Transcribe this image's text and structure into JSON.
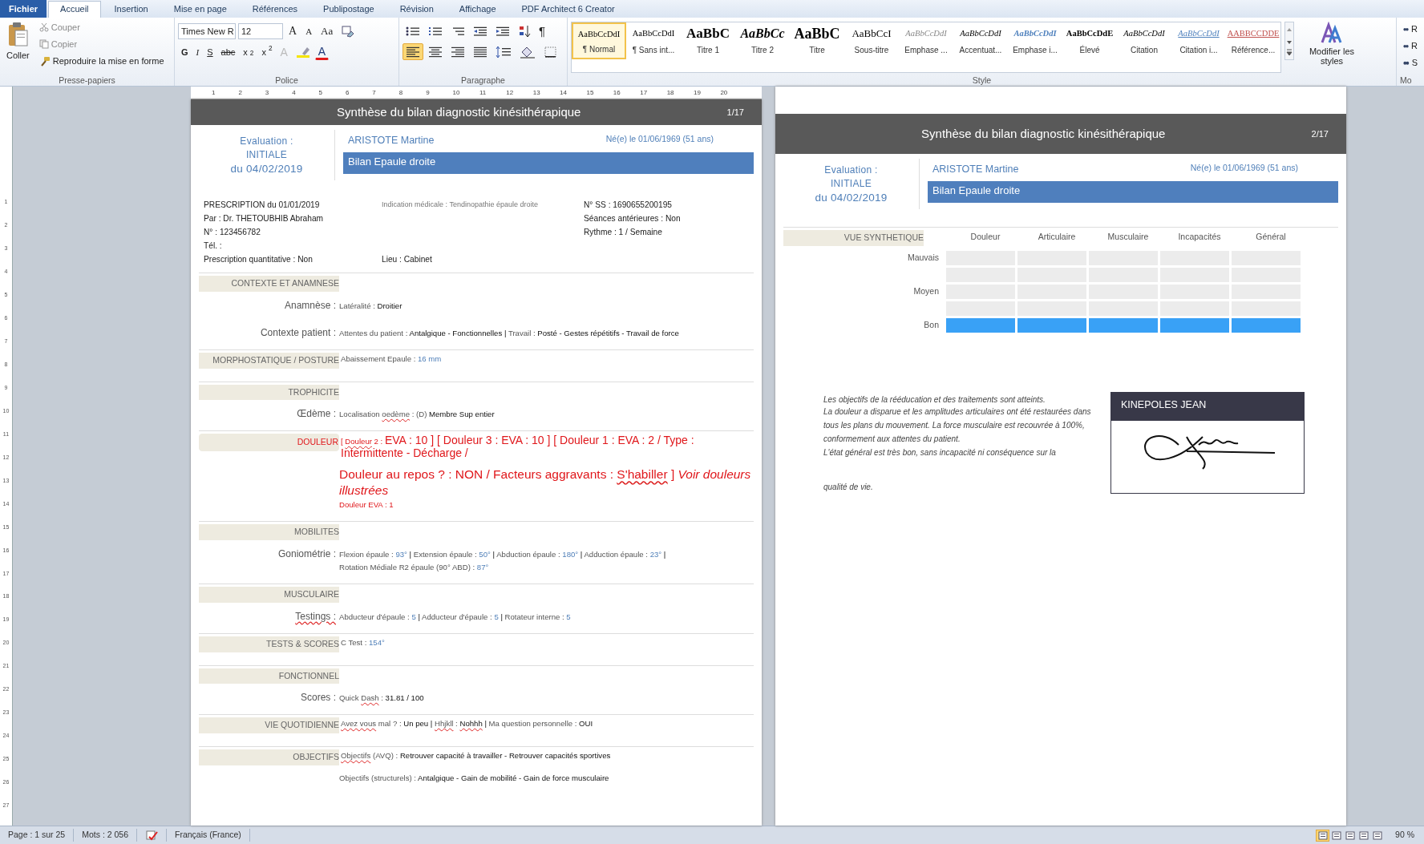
{
  "ribbon": {
    "tabs": [
      {
        "label": "Fichier",
        "kind": "file",
        "selected": false
      },
      {
        "label": "Accueil",
        "kind": "tab",
        "selected": true
      },
      {
        "label": "Insertion",
        "kind": "tab",
        "selected": false
      },
      {
        "label": "Mise en page",
        "kind": "tab",
        "selected": false
      },
      {
        "label": "Références",
        "kind": "tab",
        "selected": false
      },
      {
        "label": "Publipostage",
        "kind": "tab",
        "selected": false
      },
      {
        "label": "Révision",
        "kind": "tab",
        "selected": false
      },
      {
        "label": "Affichage",
        "kind": "tab",
        "selected": false
      },
      {
        "label": "PDF Architect 6 Creator",
        "kind": "tab",
        "selected": false
      }
    ],
    "clipboard": {
      "paste": "Coller",
      "cut": "Couper",
      "copy": "Copier",
      "format_painter": "Reproduire la mise en forme",
      "title": "Presse-papiers"
    },
    "font": {
      "font_name": "Times New R",
      "font_size": "12",
      "grow": "A",
      "shrink": "A",
      "change_case": "Aa",
      "bold": "G",
      "italic": "I",
      "underline": "S",
      "strikethrough": "abc",
      "subscript": "x$_{2}$",
      "superscript": "x$^{2}$",
      "text_effects": "A",
      "font_color": "A",
      "title": "Police"
    },
    "paragraph": {
      "pilcrow": "¶",
      "alignments": [
        {
          "selected": true
        },
        {
          "selected": false
        },
        {
          "selected": false
        },
        {
          "selected": false
        }
      ],
      "title": "Paragraphe"
    },
    "styles": {
      "items": [
        {
          "preview": "AaBbCcDdI",
          "name": "¶ Normal",
          "kind": "normal",
          "selected": true
        },
        {
          "preview": "AaBbCcDdI",
          "name": "¶ Sans int...",
          "kind": "normal",
          "selected": false
        },
        {
          "preview": "AaBbC",
          "name": "Titre 1",
          "kind": "heading1",
          "selected": false
        },
        {
          "preview": "AaBbCc",
          "name": "Titre 2",
          "kind": "heading2",
          "selected": false
        },
        {
          "preview": "AaBbC",
          "name": "Titre",
          "kind": "title",
          "selected": false
        },
        {
          "preview": "AaBbCcI",
          "name": "Sous-titre",
          "kind": "subtitle",
          "selected": false
        },
        {
          "preview": "AaBbCcDdI",
          "name": "Emphase ...",
          "kind": "subtle",
          "selected": false
        },
        {
          "preview": "AaBbCcDdI",
          "name": "Accentuat...",
          "kind": "emphasis",
          "selected": false
        },
        {
          "preview": "AaBbCcDdI",
          "name": "Emphase i...",
          "kind": "intense",
          "selected": false
        },
        {
          "preview": "AaBbCcDdE",
          "name": "Élevé",
          "kind": "strong",
          "selected": false
        },
        {
          "preview": "AaBbCcDdI",
          "name": "Citation",
          "kind": "emphasis",
          "selected": false
        },
        {
          "preview": "AaBbCcDdI",
          "name": "Citation i...",
          "kind": "quote",
          "selected": false
        },
        {
          "preview": "AABBCCDDE",
          "name": "Référence...",
          "kind": "reference",
          "selected": false
        }
      ],
      "change_styles": "Modifier les styles",
      "title": "Style"
    },
    "editing": {
      "items": [
        "R",
        "R",
        "S"
      ],
      "title": "Mo"
    }
  },
  "ruler": {
    "marks": [
      "1",
      "2",
      "3",
      "4",
      "5",
      "6",
      "7",
      "8",
      "9",
      "10",
      "11",
      "12",
      "13",
      "14",
      "15",
      "16",
      "17",
      "18",
      "19",
      "20"
    ]
  },
  "vertical_ruler": {
    "marks": [
      "1",
      "2",
      "3",
      "4",
      "5",
      "6",
      "7",
      "8",
      "9",
      "10",
      "11",
      "12",
      "13",
      "14",
      "15",
      "16",
      "17",
      "18",
      "19",
      "20",
      "21",
      "22",
      "23",
      "24",
      "25",
      "26",
      "27"
    ]
  },
  "pages": [
    {
      "title": "Synthèse du bilan diagnostic kinésithérapique",
      "page_number": "1/17",
      "evaluation": {
        "label": "Evaluation :",
        "type": "INITIALE",
        "date": "du 04/02/2019"
      },
      "patient": "ARISTOTE  Martine",
      "birth": "Né(e) le 01/06/1969 (51 ans)",
      "bilan": "Bilan  Epaule  droite",
      "prescription": {
        "left": [
          "PRESCRIPTION du 01/01/2019",
          "Par : Dr. THETOUBHIB Abraham",
          "N° : 123456782",
          "Tél. :",
          "Prescription quantitative : Non"
        ],
        "indication": "Indication médicale : Tendinopathie épaule droite",
        "place": "Lieu : Cabinet",
        "right": [
          "N° SS : 1690655200195",
          "Séances antérieures : Non",
          "Rythme : 1 / Semaine"
        ]
      },
      "sections": [
        {
          "title": "CONTEXTE  ET  ANAMNESE",
          "rows": [
            {
              "label": "Anamnèse :",
              "lines": [
                [
                  {
                    "text": "Latéralité : ",
                    "kind": "label"
                  },
                  {
                    "text": "Droitier",
                    "kind": "value"
                  }
                ]
              ]
            },
            {
              "label": "Contexte patient :",
              "lines": [
                [
                  {
                    "text": "Attentes du patient : ",
                    "kind": "label"
                  },
                  {
                    "text": "Antalgique - Fonctionnelles | ",
                    "kind": "value"
                  },
                  {
                    "text": "Travail : ",
                    "kind": "label"
                  },
                  {
                    "text": "Posté - Gestes répétitifs - Travail de force",
                    "kind": "value"
                  }
                ]
              ]
            }
          ]
        },
        {
          "title": "MORPHOSTATIQUE / POSTURE",
          "inline": [
            {
              "text": "Abaissement Epaule : ",
              "kind": "label"
            },
            {
              "text": "16 mm",
              "kind": "number"
            }
          ]
        },
        {
          "title": "TROPHICITE",
          "rows": [
            {
              "label": "Œdème :",
              "lines": [
                [
                  {
                    "text": "Localisation ",
                    "kind": "label"
                  },
                  {
                    "text": "oedème",
                    "kind": "label",
                    "misspelled": true
                  },
                  {
                    "text": " : (D) ",
                    "kind": "label"
                  },
                  {
                    "text": "Membre Sup entier",
                    "kind": "value"
                  }
                ]
              ]
            }
          ]
        },
        {
          "title": "DOULEUR",
          "alert": true,
          "inline": [
            {
              "text": "[ ",
              "kind": "alert-small"
            },
            {
              "text": "Douleur",
              "kind": "alert-small",
              "misspelled": true
            },
            {
              "text": " 2 : ",
              "kind": "alert-small"
            },
            {
              "text": "EVA  : 10 ] [ Douleur 3 : EVA  : 10 ] [ Douleur 1 : EVA  : 2 / Type : Intermittente - Décharge /",
              "kind": "alert-medium"
            }
          ],
          "rows": [
            {
              "lines": [
                [
                  {
                    "text": "Douleur au repos ? : NON / Facteurs aggravants : ",
                    "kind": "alert-large"
                  },
                  {
                    "text": "S'habiller",
                    "kind": "alert-large",
                    "misspelled": true
                  },
                  {
                    "text": " ] *Voir douleurs illustrées*",
                    "kind": "alert-large"
                  }
                ],
                [
                  {
                    "text": "Douleur EVA : 1",
                    "kind": "alert-small"
                  }
                ]
              ]
            }
          ]
        },
        {
          "title": "MOBILITES",
          "rows": [
            {
              "label": "Goniométrie :",
              "lines": [
                [
                  {
                    "text": "Flexion épaule : ",
                    "kind": "label"
                  },
                  {
                    "text": "93°",
                    "kind": "number"
                  },
                  {
                    "text": " | ",
                    "kind": "value"
                  },
                  {
                    "text": "Extension épaule : ",
                    "kind": "label"
                  },
                  {
                    "text": "50°",
                    "kind": "number"
                  },
                  {
                    "text": " | ",
                    "kind": "value"
                  },
                  {
                    "text": "Abduction épaule : ",
                    "kind": "label"
                  },
                  {
                    "text": "180°",
                    "kind": "number"
                  },
                  {
                    "text": " | ",
                    "kind": "value"
                  },
                  {
                    "text": "Adduction épaule : ",
                    "kind": "label"
                  },
                  {
                    "text": "23°",
                    "kind": "number"
                  },
                  {
                    "text": " |",
                    "kind": "value"
                  }
                ],
                [
                  {
                    "text": "Rotation Médiale R2 épaule (90° ABD) : ",
                    "kind": "label"
                  },
                  {
                    "text": "87°",
                    "kind": "number"
                  }
                ]
              ]
            }
          ]
        },
        {
          "title": "MUSCULAIRE",
          "rows": [
            {
              "label": "Testings :",
              "label_misspelled": true,
              "lines": [
                [
                  {
                    "text": "Abducteur d'épaule : ",
                    "kind": "label"
                  },
                  {
                    "text": "5",
                    "kind": "number"
                  },
                  {
                    "text": " | ",
                    "kind": "value"
                  },
                  {
                    "text": "Adducteur d'épaule : ",
                    "kind": "label"
                  },
                  {
                    "text": "5",
                    "kind": "number"
                  },
                  {
                    "text": " | ",
                    "kind": "value"
                  },
                  {
                    "text": "Rotateur interne : ",
                    "kind": "label"
                  },
                  {
                    "text": "5",
                    "kind": "number"
                  }
                ]
              ]
            }
          ]
        },
        {
          "title": "TESTS & SCORES",
          "inline": [
            {
              "text": "C Test : ",
              "kind": "label"
            },
            {
              "text": "154°",
              "kind": "number"
            }
          ]
        },
        {
          "title": "FONCTIONNEL",
          "rows": [
            {
              "label": "Scores :",
              "lines": [
                [
                  {
                    "text": "Quick ",
                    "kind": "label"
                  },
                  {
                    "text": "Dash",
                    "kind": "label",
                    "misspelled": true
                  },
                  {
                    "text": " : ",
                    "kind": "label"
                  },
                  {
                    "text": "31.81 / 100",
                    "kind": "value"
                  }
                ]
              ]
            }
          ]
        },
        {
          "title": "VIE QUOTIDIENNE",
          "inline": [
            {
              "text": "Avez vous",
              "kind": "label",
              "misspelled": true
            },
            {
              "text": " mal ? : ",
              "kind": "label"
            },
            {
              "text": "Un peu | ",
              "kind": "value"
            },
            {
              "text": "Hhjkll",
              "kind": "label",
              "misspelled": true
            },
            {
              "text": " : ",
              "kind": "label"
            },
            {
              "text": "Nohhh",
              "kind": "value",
              "misspelled": true
            },
            {
              "text": " | ",
              "kind": "value"
            },
            {
              "text": "Ma question personnelle : ",
              "kind": "label"
            },
            {
              "text": "OUI",
              "kind": "value"
            }
          ]
        },
        {
          "title": "OBJECTIFS",
          "inline": [
            {
              "text": "Objectifs",
              "kind": "label",
              "misspelled": true
            },
            {
              "text": " (AVQ) : ",
              "kind": "label"
            },
            {
              "text": "Retrouver capacité à travailler - Retrouver capacités sportives",
              "kind": "value"
            }
          ],
          "rows": [
            {
              "lines": [
                [
                  {
                    "text": "Objectifs (structurels) : ",
                    "kind": "label"
                  },
                  {
                    "text": "Antalgique - Gain de mobilité - Gain de force musculaire",
                    "kind": "value"
                  }
                ]
              ]
            }
          ]
        }
      ]
    },
    {
      "title": "Synthèse du bilan diagnostic kinésithérapique",
      "page_number": "2/17",
      "evaluation": {
        "label": "Evaluation :",
        "type": "INITIALE",
        "date": "du 04/02/2019"
      },
      "patient": "ARISTOTE  Martine",
      "birth": "Né(e) le 01/06/1969 (51 ans)",
      "bilan": "Bilan  Epaule  droite",
      "overview": {
        "title": "VUE SYNTHETIQUE",
        "rows": [
          {
            "label": "Mauvais"
          },
          {},
          {
            "label": "Moyen"
          },
          {},
          {
            "label": "Bon"
          }
        ],
        "columns": [
          {
            "label": "Douleur",
            "cells": [
              {
                "filled": false
              },
              {
                "filled": false
              },
              {
                "filled": false
              },
              {
                "filled": false
              },
              {
                "filled": true
              }
            ]
          },
          {
            "label": "Articulaire",
            "cells": [
              {
                "filled": false
              },
              {
                "filled": false
              },
              {
                "filled": false
              },
              {
                "filled": false
              },
              {
                "filled": true
              }
            ]
          },
          {
            "label": "Musculaire",
            "cells": [
              {
                "filled": false
              },
              {
                "filled": false
              },
              {
                "filled": false
              },
              {
                "filled": false
              },
              {
                "filled": true
              }
            ]
          },
          {
            "label": "Incapacités",
            "cells": [
              {
                "filled": false
              },
              {
                "filled": false
              },
              {
                "filled": false
              },
              {
                "filled": false
              },
              {
                "filled": true
              }
            ]
          },
          {
            "label": "Général",
            "cells": [
              {
                "filled": false
              },
              {
                "filled": false
              },
              {
                "filled": false
              },
              {
                "filled": false
              },
              {
                "filled": true
              }
            ]
          }
        ]
      },
      "conclusion": [
        "Les objectifs de la rééducation et des traitements sont atteints.",
        "La douleur a disparue et les amplitudes articulaires ont été restaurées dans tous les plans du mouvement. La force musculaire est recouvrée à 100%, conformement aux attentes du patient.",
        "L'état général est très bon, sans incapacité ni conséquence sur la",
        "qualité de vie."
      ],
      "signature": {
        "name": "KINEPOLES JEAN"
      }
    }
  ],
  "status_bar": {
    "page": "Page : 1 sur 25",
    "words": "Mots : 2 056",
    "language": "Français (France)",
    "views": [
      {
        "selected": true
      },
      {
        "selected": false
      },
      {
        "selected": false
      },
      {
        "selected": false
      },
      {
        "selected": false
      }
    ],
    "zoom": "90 %"
  }
}
